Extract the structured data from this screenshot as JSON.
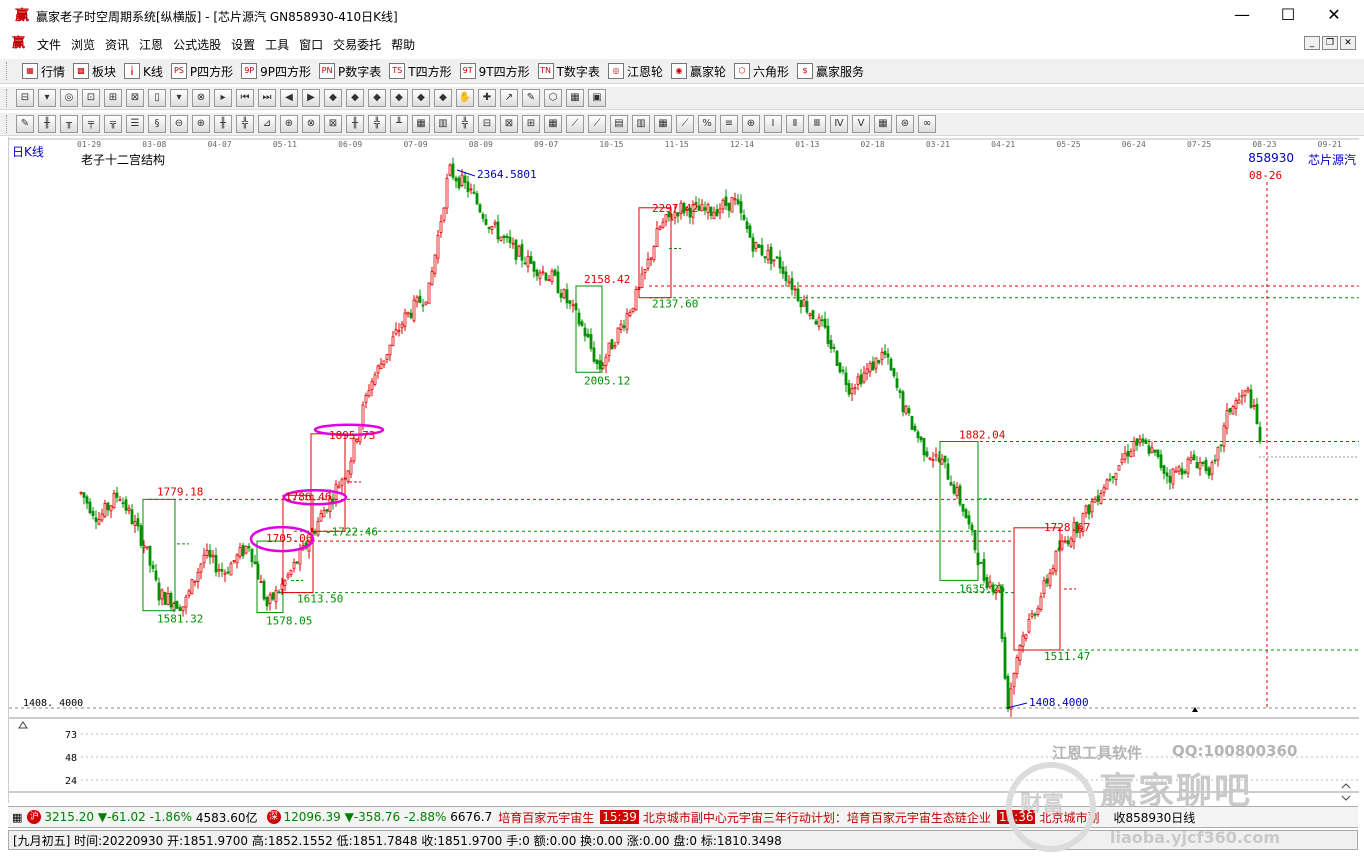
{
  "window": {
    "title": "赢家老子时空周期系统[纵横版] - [芯片源汽  GN858930-410日K线]",
    "icon": "赢",
    "minimize": "—",
    "maximize": "☐",
    "close": "✕"
  },
  "menu": [
    "文件",
    "浏览",
    "资讯",
    "江恩",
    "公式选股",
    "设置",
    "工具",
    "窗口",
    "交易委托",
    "帮助"
  ],
  "mdi_buttons": [
    "_",
    "❐",
    "✕"
  ],
  "toolbar1": [
    {
      "label": "行情",
      "icon": "grid-icon",
      "glyph": "▦"
    },
    {
      "label": "板块",
      "icon": "blocks-icon",
      "glyph": "▩"
    },
    {
      "label": "K线",
      "icon": "candle-icon",
      "glyph": "╽"
    },
    {
      "label": "P四方形",
      "icon": "p-square-icon",
      "glyph": "PS"
    },
    {
      "label": "9P四方形",
      "icon": "9p-square-icon",
      "glyph": "9P"
    },
    {
      "label": "P数字表",
      "icon": "p-number-table-icon",
      "glyph": "PN"
    },
    {
      "label": "T四方形",
      "icon": "t-square-icon",
      "glyph": "TS"
    },
    {
      "label": "9T四方形",
      "icon": "9t-square-icon",
      "glyph": "9T"
    },
    {
      "label": "T数字表",
      "icon": "t-number-table-icon",
      "glyph": "TN"
    },
    {
      "label": "江恩轮",
      "icon": "gann-wheel-icon",
      "glyph": "◎"
    },
    {
      "label": "赢家轮",
      "icon": "winner-wheel-icon",
      "glyph": "◉"
    },
    {
      "label": "六角形",
      "icon": "hexagon-icon",
      "glyph": "⬡"
    },
    {
      "label": "赢家服务",
      "icon": "dollar-icon",
      "glyph": "$"
    }
  ],
  "toolbar2_count": 27,
  "toolbar3_count": 42,
  "chart": {
    "period": "日K线",
    "indicator": "老子十二宫结构",
    "code": "858930",
    "name": "芯片源汽",
    "date_axis": [
      "01-29",
      "03-08",
      "04-07",
      "05-11",
      "06-09",
      "07-09",
      "08-09",
      "09-07",
      "10-15",
      "11-15",
      "12-14",
      "01-13",
      "02-18",
      "03-21",
      "04-21",
      "05-25",
      "06-24",
      "07-25",
      "08-23",
      "09-21"
    ],
    "vline_label": "08-26",
    "ymin_label": "1408. 4000",
    "volume_ticks": [
      "73",
      "48",
      "24"
    ],
    "price_labels": {
      "high": "2364.5801",
      "low": "1408.4000",
      "p2297": "2297.42",
      "p2158": "2158.42",
      "p2137": "2137.60",
      "p2005": "2005.12",
      "p1895": "1895.73",
      "p1882": "1882.04",
      "p1786": "1786.46",
      "p1779": "1779.18",
      "p1728": "1728.67",
      "p1722": "1722.46",
      "p1705": "1705.06",
      "p1635": "1635.25",
      "p1613": "1613.50",
      "p1581": "1581.32",
      "p1578": "1578.05",
      "p1511": "1511.47"
    },
    "y_range": [
      1360,
      2440
    ],
    "colors": {
      "up": "#e00000",
      "down": "#009000",
      "ellipse": "#e000e0",
      "blue": "#0000c0"
    }
  },
  "ticker": {
    "sh_badge": "沪",
    "sh": "3215.20",
    "sh_change": "▼-61.02",
    "sh_pct": "-1.86%",
    "sh_amount": "4583.60亿",
    "sz_badge": "深",
    "sz": "12096.39",
    "sz_change": "▼-358.76",
    "sz_pct": "-2.88%",
    "sz_amount": "6676.7",
    "news1": "培育百家元宇宙生",
    "news2_time": "15:39",
    "news2": "北京城市副中心元宇宙三年行动计划：培育百家元宇宙生态链企业",
    "news3_time": "15:36",
    "news3": "北京城市副",
    "close_code": "收858930日线"
  },
  "status": "[九月初五] 时间:20220930 开:1851.9700 高:1852.1552 低:1851.7848 收:1851.9700 手:0 额:0.00 换:0.00 涨:0.00 盘:0 标:1810.3498",
  "watermark": {
    "tool": "江恩工具软件",
    "qq": "QQ:100800360",
    "big": "赢家聊吧",
    "url": "liaoba.yjcf360.com",
    "logo": "财富"
  }
}
